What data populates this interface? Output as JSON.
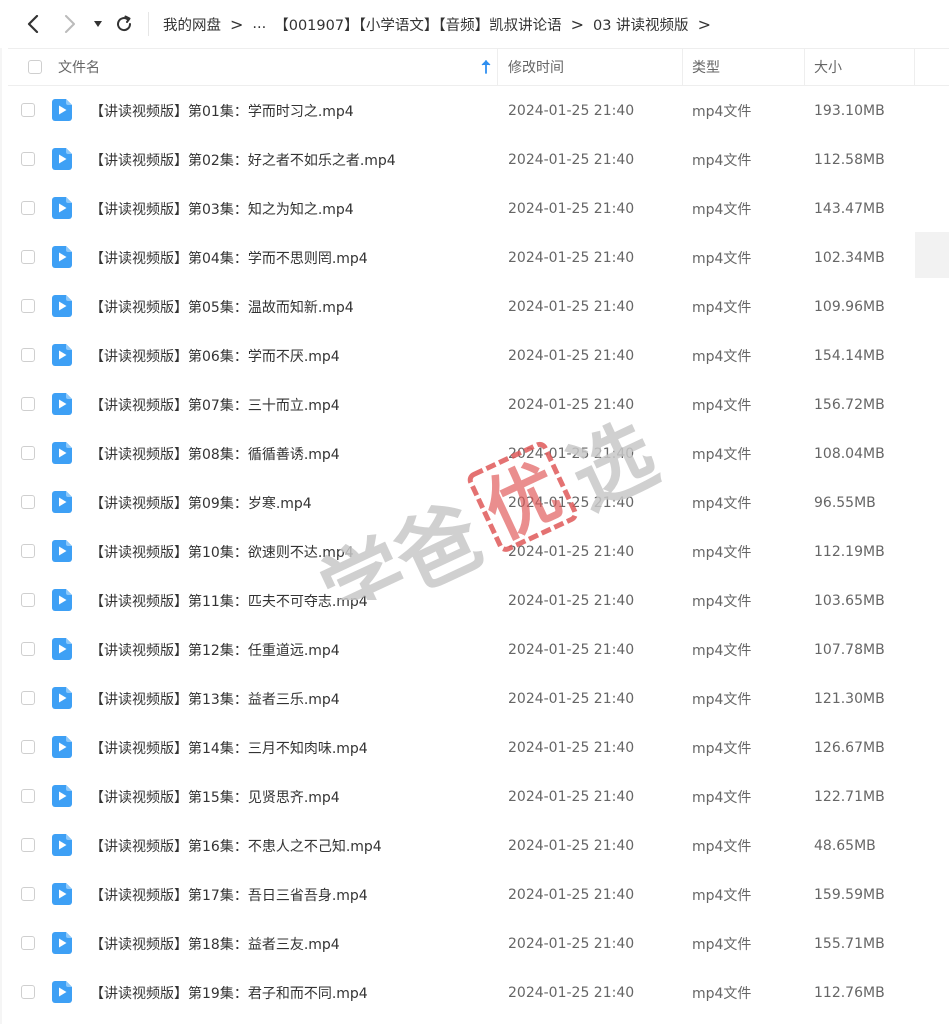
{
  "nav": {
    "icons": [
      "back-arrow-icon",
      "forward-arrow-icon",
      "dropdown-triangle-icon",
      "refresh-icon"
    ]
  },
  "breadcrumb": {
    "items": [
      "我的网盘",
      "...",
      "【001907】【小学语文】【音频】凯叔讲论语",
      "03 讲读视频版"
    ],
    "separator": ">"
  },
  "table": {
    "headers": {
      "name": "文件名",
      "modified": "修改时间",
      "type": "类型",
      "size": "大小"
    },
    "rows": [
      {
        "name": "【讲读视频版】第01集：学而时习之.mp4",
        "modified": "2024-01-25 21:40",
        "type": "mp4文件",
        "size": "193.10MB"
      },
      {
        "name": "【讲读视频版】第02集：好之者不如乐之者.mp4",
        "modified": "2024-01-25 21:40",
        "type": "mp4文件",
        "size": "112.58MB"
      },
      {
        "name": "【讲读视频版】第03集：知之为知之.mp4",
        "modified": "2024-01-25 21:40",
        "type": "mp4文件",
        "size": "143.47MB"
      },
      {
        "name": "【讲读视频版】第04集：学而不思则罔.mp4",
        "modified": "2024-01-25 21:40",
        "type": "mp4文件",
        "size": "102.34MB"
      },
      {
        "name": "【讲读视频版】第05集：温故而知新.mp4",
        "modified": "2024-01-25 21:40",
        "type": "mp4文件",
        "size": "109.96MB"
      },
      {
        "name": "【讲读视频版】第06集：学而不厌.mp4",
        "modified": "2024-01-25 21:40",
        "type": "mp4文件",
        "size": "154.14MB"
      },
      {
        "name": "【讲读视频版】第07集：三十而立.mp4",
        "modified": "2024-01-25 21:40",
        "type": "mp4文件",
        "size": "156.72MB"
      },
      {
        "name": "【讲读视频版】第08集：循循善诱.mp4",
        "modified": "2024-01-25 21:40",
        "type": "mp4文件",
        "size": "108.04MB"
      },
      {
        "name": "【讲读视频版】第09集：岁寒.mp4",
        "modified": "2024-01-25 21:40",
        "type": "mp4文件",
        "size": "96.55MB"
      },
      {
        "name": "【讲读视频版】第10集：欲速则不达.mp4",
        "modified": "2024-01-25 21:40",
        "type": "mp4文件",
        "size": "112.19MB"
      },
      {
        "name": "【讲读视频版】第11集：匹夫不可夺志.mp4",
        "modified": "2024-01-25 21:40",
        "type": "mp4文件",
        "size": "103.65MB"
      },
      {
        "name": "【讲读视频版】第12集：任重道远.mp4",
        "modified": "2024-01-25 21:40",
        "type": "mp4文件",
        "size": "107.78MB"
      },
      {
        "name": "【讲读视频版】第13集：益者三乐.mp4",
        "modified": "2024-01-25 21:40",
        "type": "mp4文件",
        "size": "121.30MB"
      },
      {
        "name": "【讲读视频版】第14集：三月不知肉味.mp4",
        "modified": "2024-01-25 21:40",
        "type": "mp4文件",
        "size": "126.67MB"
      },
      {
        "name": "【讲读视频版】第15集：见贤思齐.mp4",
        "modified": "2024-01-25 21:40",
        "type": "mp4文件",
        "size": "122.71MB"
      },
      {
        "name": "【讲读视频版】第16集：不患人之不己知.mp4",
        "modified": "2024-01-25 21:40",
        "type": "mp4文件",
        "size": "48.65MB"
      },
      {
        "name": "【讲读视频版】第17集：吾日三省吾身.mp4",
        "modified": "2024-01-25 21:40",
        "type": "mp4文件",
        "size": "159.59MB"
      },
      {
        "name": "【讲读视频版】第18集：益者三友.mp4",
        "modified": "2024-01-25 21:40",
        "type": "mp4文件",
        "size": "155.71MB"
      },
      {
        "name": "【讲读视频版】第19集：君子和而不同.mp4",
        "modified": "2024-01-25 21:40",
        "type": "mp4文件",
        "size": "112.76MB"
      }
    ]
  },
  "watermark": {
    "text_left": "学爸",
    "text_seal": "优",
    "text_right": "选"
  },
  "colors": {
    "accent": "#2f8ff0",
    "file_icon": "#3ea0f5",
    "seal_red": "#e05a5a",
    "watermark_gray": "#c8c8c8"
  }
}
